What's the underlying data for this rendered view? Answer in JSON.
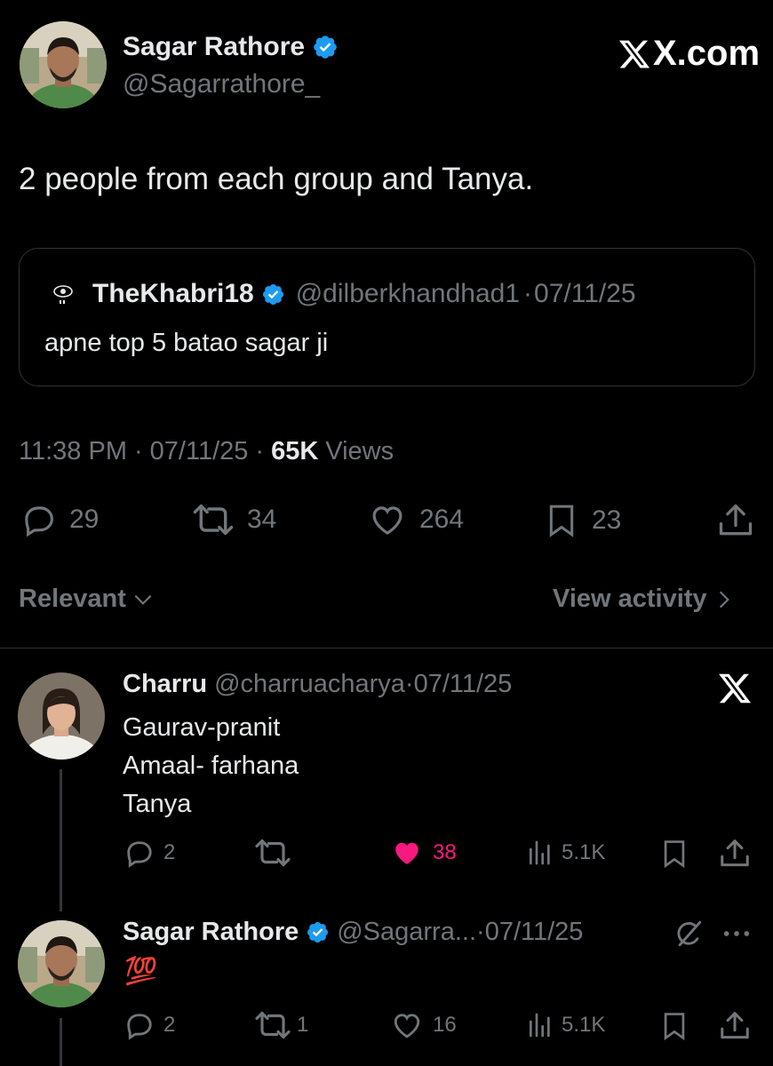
{
  "brand": {
    "watermark": "X.com"
  },
  "tweet": {
    "author_name": "Sagar Rathore",
    "author_handle": "@Sagarrathore_",
    "text": "2 people from each group and Tanya.",
    "quote": {
      "author_name": "TheKhabri18",
      "author_handle": "@dilberkhandhad1",
      "date": "07/11/25",
      "text": "apne top 5 batao sagar ji"
    },
    "meta": {
      "time": "11:38 PM",
      "date": "07/11/25",
      "views_count": "65K",
      "views_label": "Views"
    },
    "stats": {
      "replies": "29",
      "reposts": "34",
      "likes": "264",
      "bookmarks": "23"
    }
  },
  "controls": {
    "sort_label": "Relevant",
    "activity_label": "View activity"
  },
  "replies": [
    {
      "author_name": "Charru",
      "author_handle": "@charruacharya",
      "date": "07/11/25",
      "lines": [
        "Gaurav-pranit",
        "Amaal- farhana",
        "Tanya"
      ],
      "stats": {
        "replies": "2",
        "reposts": "",
        "likes": "38",
        "views": "5.1K"
      },
      "liked": true
    },
    {
      "author_name": "Sagar Rathore",
      "author_handle": "@Sagarra...",
      "date": "07/11/25",
      "text": "💯",
      "stats": {
        "replies": "2",
        "reposts": "1",
        "likes": "16",
        "views": "5.1K"
      },
      "liked": false
    }
  ],
  "colors": {
    "background": "#000000",
    "text": "#e7e9ea",
    "muted": "#71767b",
    "verified": "#1d9bf0",
    "like_active": "#f91880",
    "border": "#2f3336"
  },
  "icons": [
    "verified-badge-icon",
    "reply-icon",
    "repost-icon",
    "like-icon",
    "bookmark-icon",
    "share-icon",
    "views-icon",
    "chevron-down-icon",
    "chevron-right-icon",
    "x-logo-icon",
    "grok-icon",
    "more-icon"
  ]
}
